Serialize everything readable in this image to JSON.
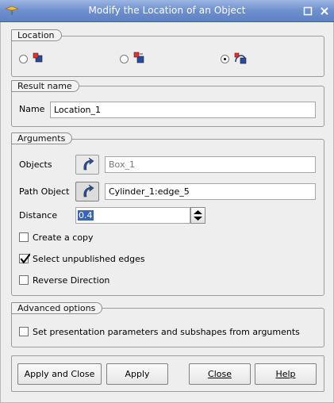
{
  "window": {
    "title": "Modify the Location of an Object"
  },
  "location_group": {
    "title": "Location",
    "options": [
      {
        "selected": false,
        "icon": "location-by-coords-icon"
      },
      {
        "selected": false,
        "icon": "location-by-reference-icon"
      },
      {
        "selected": true,
        "icon": "location-by-path-icon"
      }
    ]
  },
  "result_group": {
    "title": "Result name",
    "name_label": "Name",
    "name_value": "Location_1"
  },
  "arguments_group": {
    "title": "Arguments",
    "objects_label": "Objects",
    "objects_value": "Box_1",
    "path_label": "Path Object",
    "path_value": "Cylinder_1:edge_5",
    "distance_label": "Distance",
    "distance_value": "0.4",
    "create_copy_label": "Create a copy",
    "create_copy_checked": false,
    "select_unpublished_label": "Select unpublished edges",
    "select_unpublished_checked": true,
    "reverse_direction_label": "Reverse Direction",
    "reverse_direction_checked": false
  },
  "advanced_group": {
    "title": "Advanced options",
    "presentation_label": "Set presentation parameters and subshapes from arguments",
    "presentation_checked": false
  },
  "buttons": {
    "apply_close": "Apply and Close",
    "apply": "Apply",
    "close": "Close",
    "help": "Help"
  }
}
